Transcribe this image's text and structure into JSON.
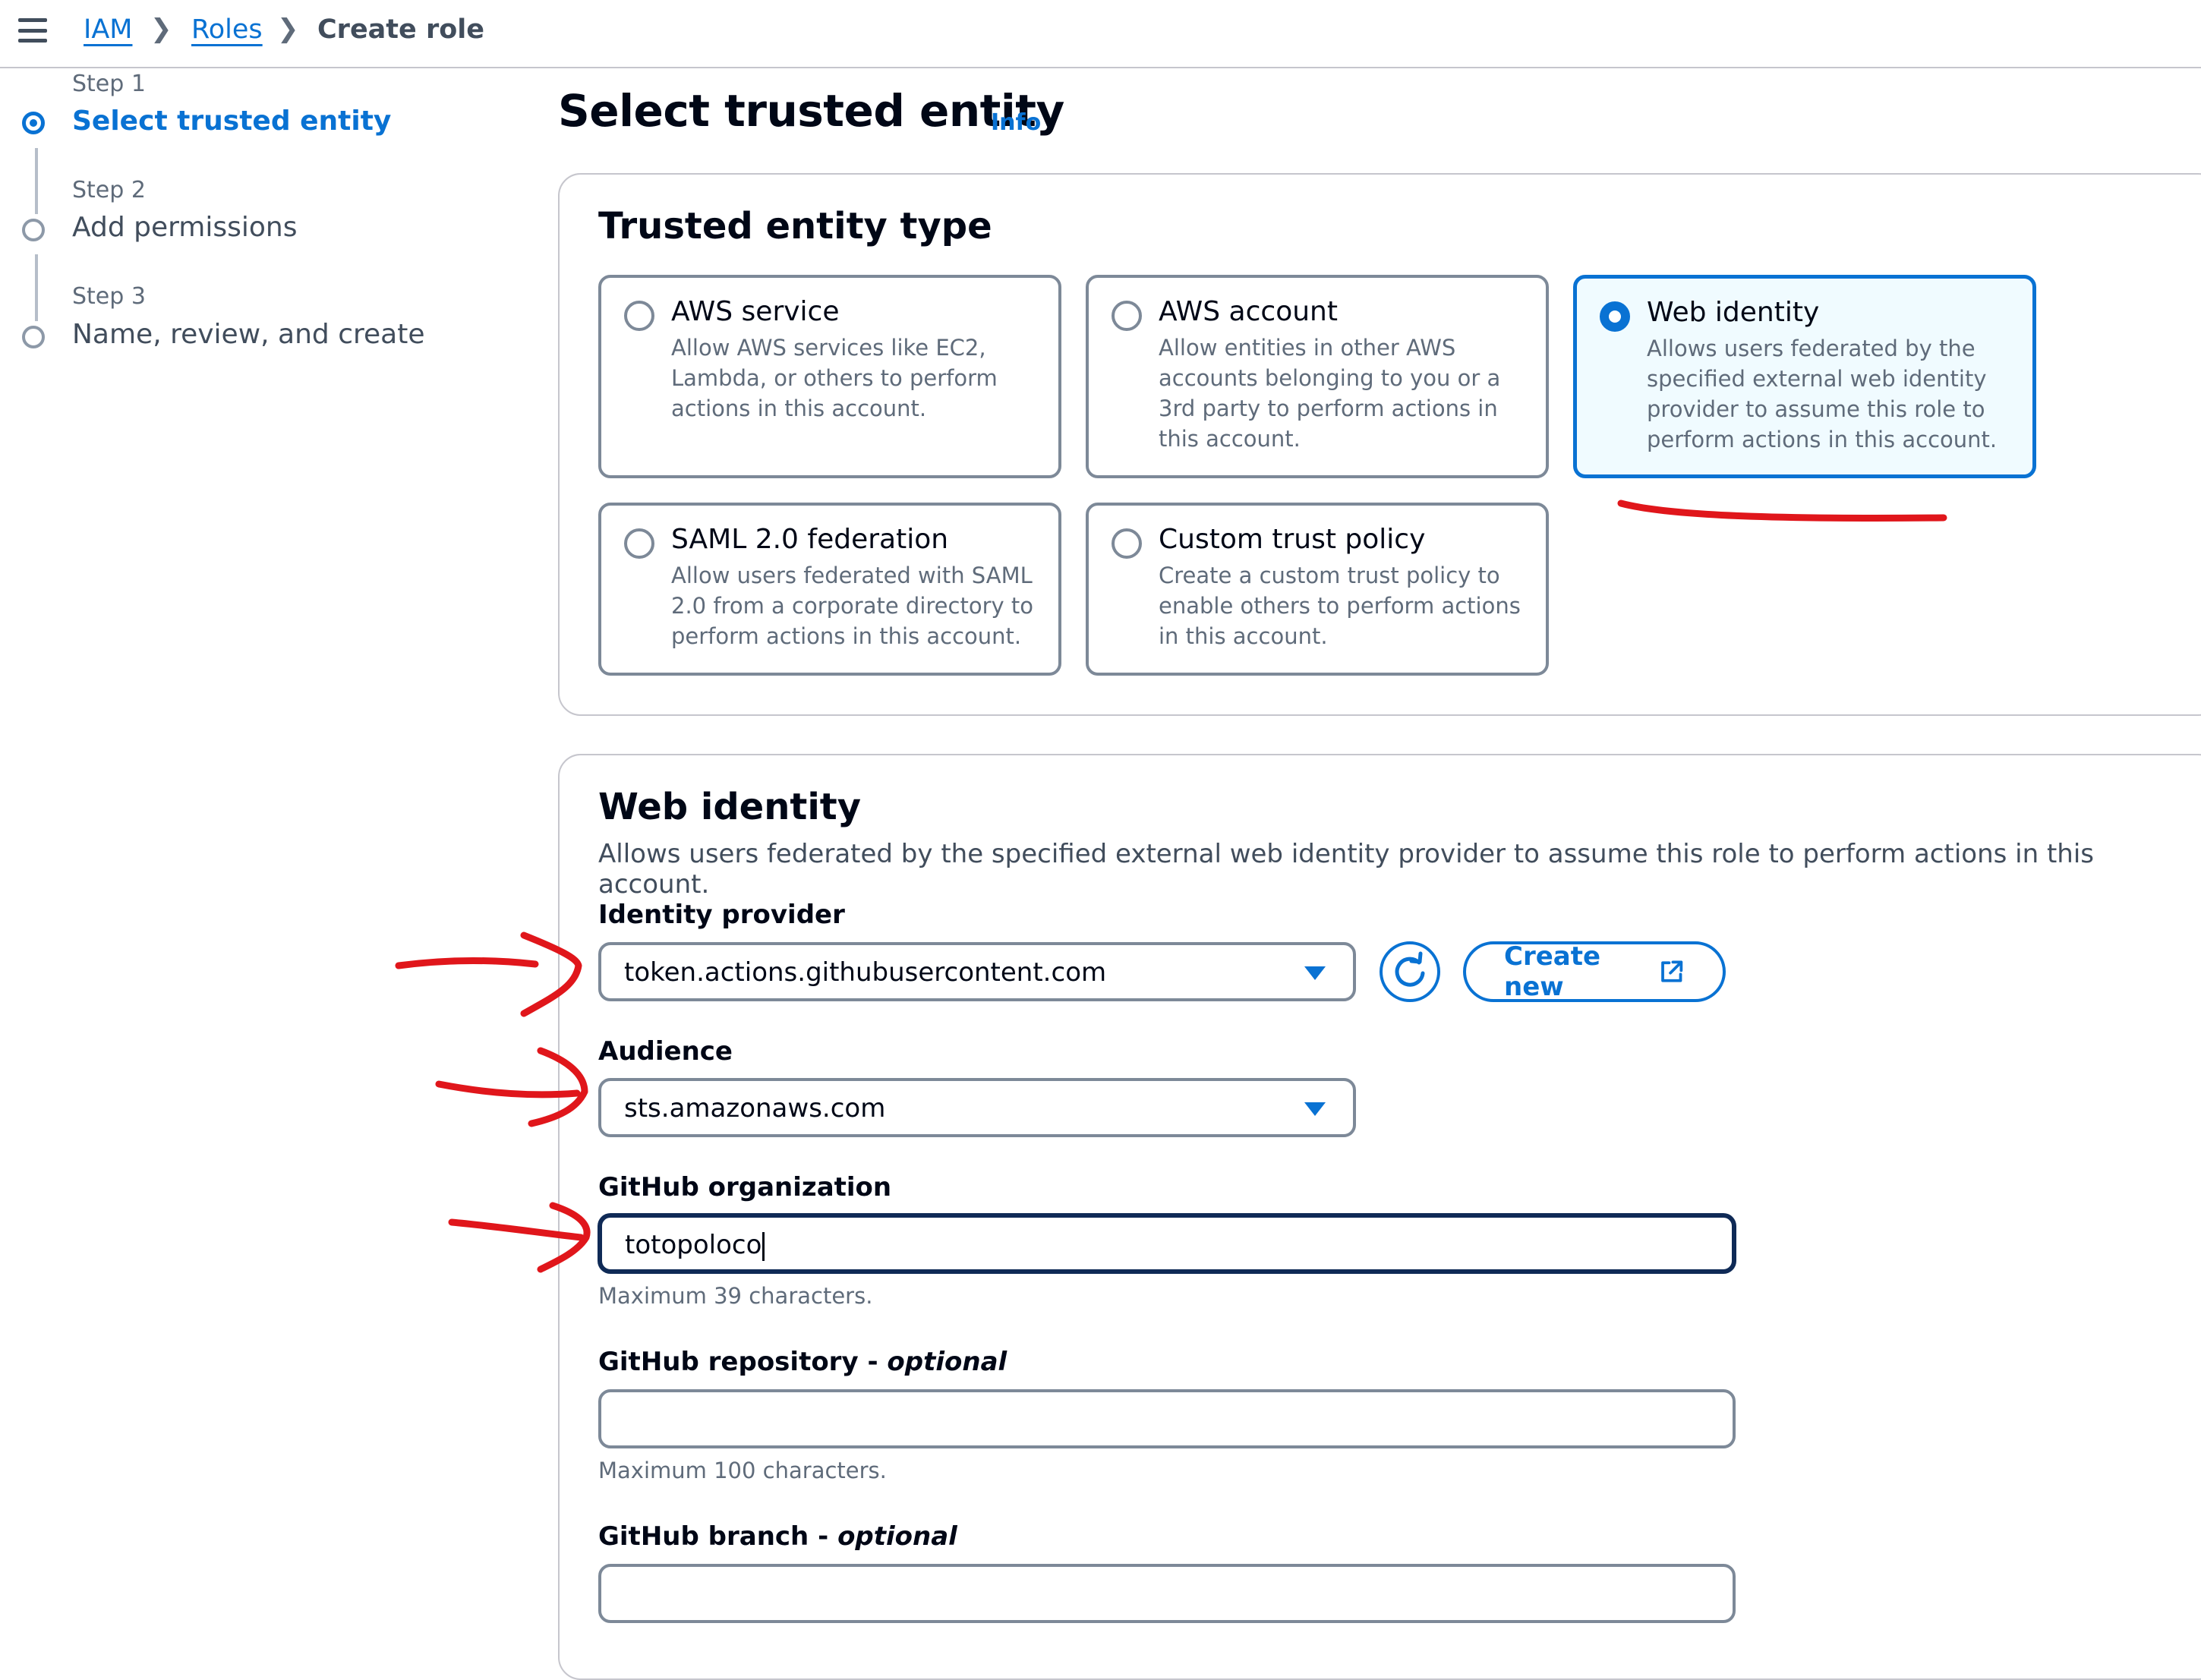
{
  "breadcrumb": {
    "items": [
      "IAM",
      "Roles"
    ],
    "current": "Create role"
  },
  "steps": [
    {
      "step": "Step 1",
      "title": "Select trusted entity",
      "active": true
    },
    {
      "step": "Step 2",
      "title": "Add permissions",
      "active": false
    },
    {
      "step": "Step 3",
      "title": "Name, review, and create",
      "active": false
    }
  ],
  "page": {
    "title": "Select trusted entity",
    "info": "Info"
  },
  "trusted_entity": {
    "heading": "Trusted entity type",
    "options": [
      {
        "title": "AWS service",
        "desc": "Allow AWS services like EC2, Lambda, or others to perform actions in this account.",
        "selected": false
      },
      {
        "title": "AWS account",
        "desc": "Allow entities in other AWS accounts belonging to you or a 3rd party to perform actions in this account.",
        "selected": false
      },
      {
        "title": "Web identity",
        "desc": "Allows users federated by the specified external web identity provider to assume this role to perform actions in this account.",
        "selected": true
      },
      {
        "title": "SAML 2.0 federation",
        "desc": "Allow users federated with SAML 2.0 from a corporate directory to perform actions in this account.",
        "selected": false
      },
      {
        "title": "Custom trust policy",
        "desc": "Create a custom trust policy to enable others to perform actions in this account.",
        "selected": false
      }
    ]
  },
  "web_identity": {
    "heading": "Web identity",
    "description": "Allows users federated by the specified external web identity provider to assume this role to perform actions in this account.",
    "identity_provider": {
      "label": "Identity provider",
      "value": "token.actions.githubusercontent.com"
    },
    "create_new_label": "Create new",
    "audience": {
      "label": "Audience",
      "value": "sts.amazonaws.com"
    },
    "github_org": {
      "label": "GitHub organization",
      "value": "totopoloco",
      "hint": "Maximum 39 characters."
    },
    "github_repo": {
      "label": "GitHub repository",
      "optional": "optional",
      "value": "",
      "hint": "Maximum 100 characters."
    },
    "github_branch": {
      "label": "GitHub branch",
      "optional": "optional",
      "value": ""
    }
  },
  "colors": {
    "accent": "#0972d3",
    "annotation": "#e0161b"
  }
}
